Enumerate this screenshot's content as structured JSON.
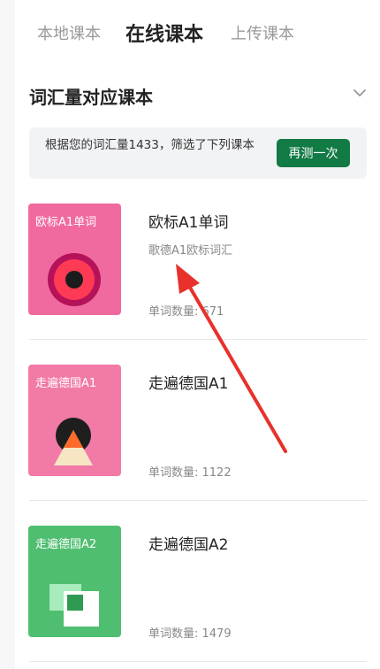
{
  "tabs": [
    {
      "label": "本地课本",
      "active": false
    },
    {
      "label": "在线课本",
      "active": true
    },
    {
      "label": "上传课本",
      "active": false
    }
  ],
  "section": {
    "title": "词汇量对应课本",
    "chevron_icon": "chevron-down-icon"
  },
  "notice": {
    "text": "根据您的词汇量1433，筛选了下列课本",
    "button_label": "再测一次",
    "button_color": "#127a45"
  },
  "books": [
    {
      "cover_label": "欧标A1单词",
      "cover_color": "#f06aa0",
      "title": "欧标A1单词",
      "subtitle": "歌德A1欧标词汇",
      "count_label": "单词数量: ",
      "count_value": "671"
    },
    {
      "cover_label": "走遍德国A1",
      "cover_color": "#f27aa6",
      "title": "走遍德国A1",
      "subtitle": "",
      "count_label": "单词数量: ",
      "count_value": "1122"
    },
    {
      "cover_label": "走遍德国A2",
      "cover_color": "#4fbe70",
      "title": "走遍德国A2",
      "subtitle": "",
      "count_label": "单词数量: ",
      "count_value": "1479"
    }
  ],
  "annotation": {
    "arrow_color": "#e8312a",
    "arrow_icon": "red-annotation-arrow"
  }
}
